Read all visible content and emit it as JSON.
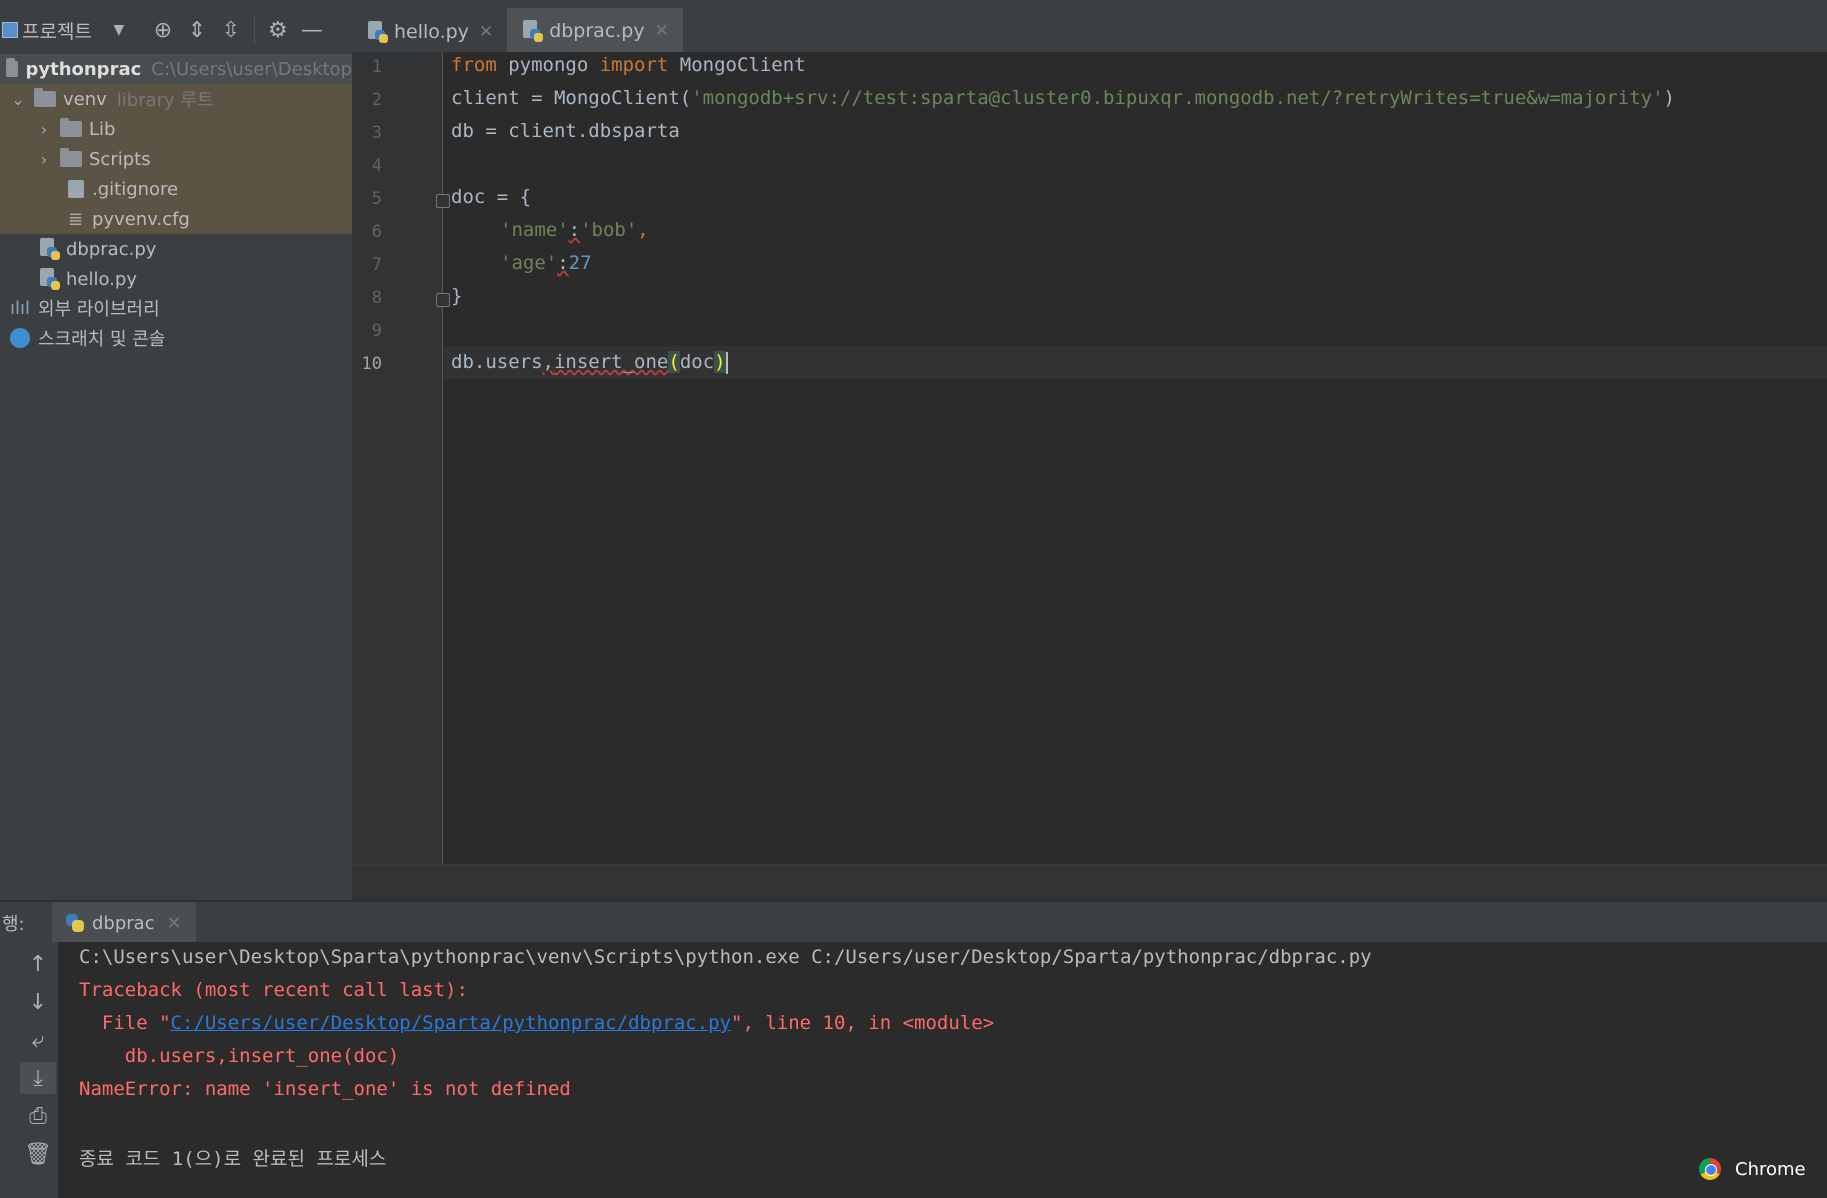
{
  "toolbar": {
    "project_label": "프로젝트",
    "icons": [
      "dropdown-icon",
      "locate-icon",
      "expand-all-icon",
      "collapse-all-icon",
      "gear-icon",
      "minimize-icon"
    ]
  },
  "tabs": [
    {
      "label": "hello.py",
      "active": false
    },
    {
      "label": "dbprac.py",
      "active": true
    }
  ],
  "project_tree": {
    "root": {
      "name": "pythonprac",
      "path": "C:\\Users\\user\\Desktop"
    },
    "venv": {
      "name": "venv",
      "hint": "library 루트"
    },
    "lib": "Lib",
    "scripts": "Scripts",
    "gitignore": ".gitignore",
    "pyvenv": "pyvenv.cfg",
    "dbprac": "dbprac.py",
    "hello": "hello.py",
    "external": "외부 라이브러리",
    "scratches": "스크래치 및 콘솔"
  },
  "editor": {
    "line_numbers": [
      "1",
      "2",
      "3",
      "4",
      "5",
      "6",
      "7",
      "8",
      "9",
      "10"
    ],
    "current_line": "10",
    "l1": {
      "kw1": "from",
      "mod": " pymongo ",
      "kw2": "import",
      "cls": " MongoClient"
    },
    "l2": {
      "pre": "client = MongoClient(",
      "str": "'mongodb+srv://test:sparta@cluster0.bipuxqr.mongodb.net/?retryWrites=true&w=majority'",
      "post": ")"
    },
    "l3": "db = client.dbsparta",
    "l5": "doc = {",
    "l6": {
      "key": "'name'",
      "colon": ":",
      "val": "'bob'",
      "comma": ","
    },
    "l7": {
      "key": "'age'",
      "colon": ":",
      "val": "27"
    },
    "l8": "}",
    "l10": {
      "pre": "db.users",
      "comma": ",",
      "fn": "insert_one",
      "open": "(",
      "arg": "doc",
      "close": ")"
    }
  },
  "run": {
    "label": "행:",
    "tab": "dbprac",
    "console": {
      "cmd": "C:\\Users\\user\\Desktop\\Sparta\\pythonprac\\venv\\Scripts\\python.exe C:/Users/user/Desktop/Sparta/pythonprac/dbprac.py",
      "traceback": "Traceback (most recent call last):",
      "file_pre": "  File \"",
      "file_link": "C:/Users/user/Desktop/Sparta/pythonprac/dbprac.py",
      "file_post": "\", line 10, in <module>",
      "src": "    db.users,insert_one(doc)",
      "error": "NameError: name 'insert_one' is not defined",
      "exit": "종료 코드 1(으)로 완료된 프로세스"
    },
    "side_icons": [
      "up-arrow-icon",
      "down-arrow-icon",
      "soft-wrap-icon",
      "scroll-to-end-icon",
      "print-icon",
      "trash-icon"
    ]
  },
  "taskbar": {
    "chrome_label": "Chrome"
  },
  "colors": {
    "keyword": "#cc7832",
    "string": "#6a8759",
    "number": "#6897bb",
    "error": "#ff6b68",
    "link": "#287bde",
    "accent": "#4a88c7"
  }
}
